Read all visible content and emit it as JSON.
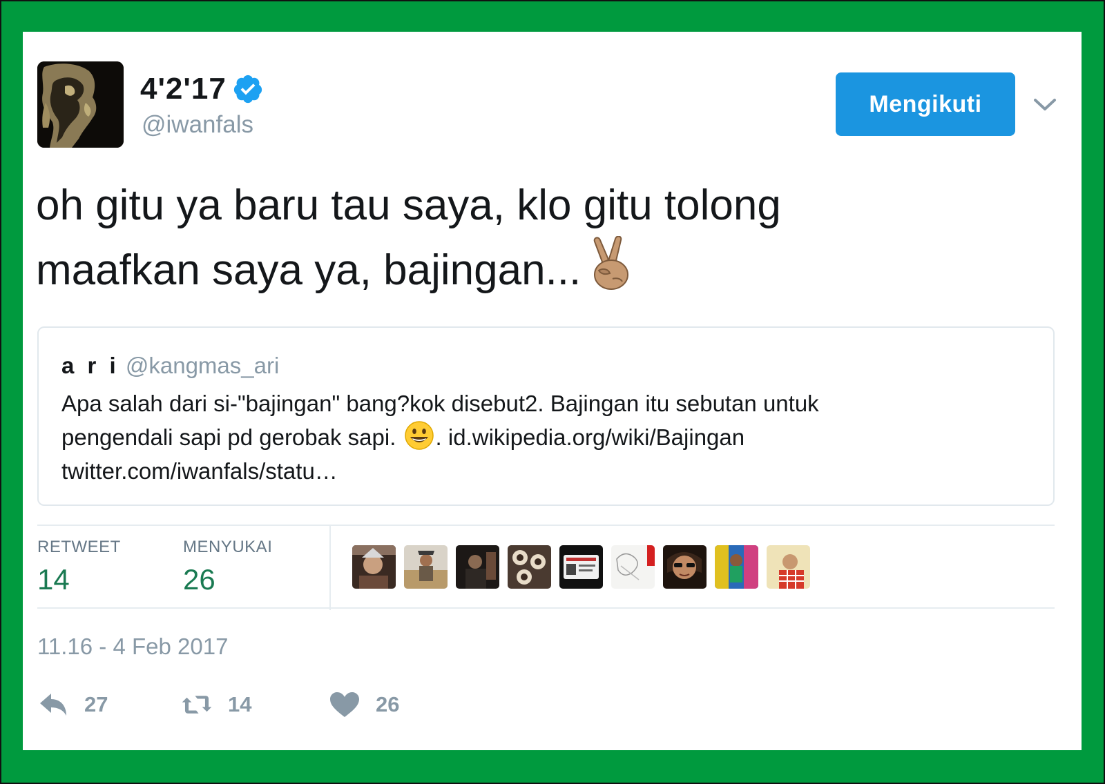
{
  "tweet": {
    "display_name": "4'2'17",
    "handle": "@iwanfals",
    "follow_button": "Mengikuti",
    "text_line1": "oh gitu ya baru tau saya, klo gitu tolong",
    "text_line2": "maafkan saya ya, bajingan...",
    "emoji": "peace-hand-emoji"
  },
  "quoted_tweet": {
    "name": "a r i",
    "handle": "@kangmas_ari",
    "line1": "Apa salah dari si-\"bajingan\" bang?kok disebut2. Bajingan itu sebutan untuk",
    "line2_before": "pengendali sapi pd gerobak sapi.",
    "line2_after": ". id.wikipedia.org/wiki/Bajingan",
    "line3": "twitter.com/iwanfals/statu…",
    "emoji": "smiling-face-emoji"
  },
  "stats": {
    "retweet_label": "RETWEET",
    "retweet_count": "14",
    "like_label": "MENYUKAI",
    "like_count": "26",
    "liker_avatars": 9
  },
  "timestamp": "11.16 - 4 Feb 2017",
  "actions": {
    "reply_count": "27",
    "retweet_count": "14",
    "like_count": "26"
  },
  "colors": {
    "frame": "#009a3e",
    "follow_button": "#1b95e0",
    "stat_value": "#1a7a52",
    "muted": "#8899a6"
  }
}
